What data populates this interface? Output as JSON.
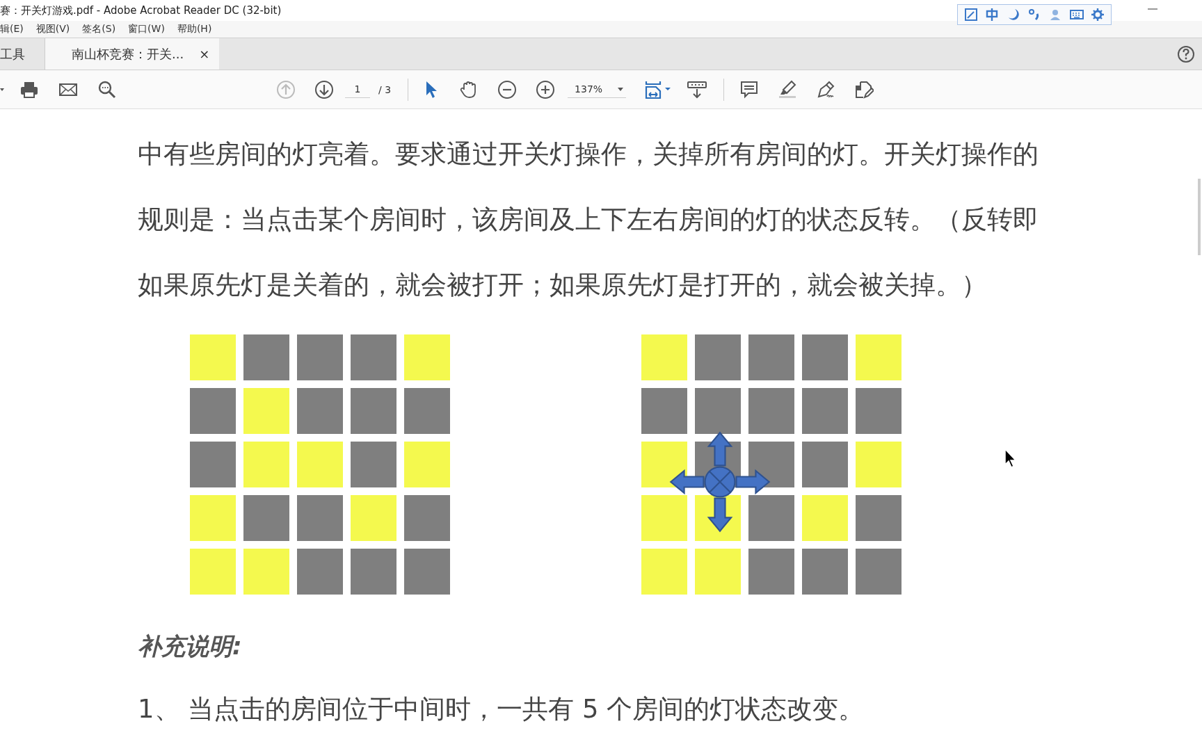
{
  "window": {
    "title": "赛：开关灯游戏.pdf - Adobe Acrobat Reader DC (32-bit)"
  },
  "menu": [
    "辑(E)",
    "视图(V)",
    "签名(S)",
    "窗口(W)",
    "帮助(H)"
  ],
  "tabs": [
    {
      "label": "工具",
      "selected": false,
      "closable": false
    },
    {
      "label": "南山杯竞赛：开关...",
      "selected": true,
      "closable": true
    }
  ],
  "tab_close": "×",
  "toolbar": {
    "page": "1",
    "page_total": "/ 3",
    "zoom": "137%"
  },
  "document": {
    "lines": [
      "中有些房间的灯亮着。要求通过开关灯操作，关掉所有房间的灯。开关灯操作的",
      "规则是：当点击某个房间时，该房间及上下左右房间的灯的状态反转。（反转即",
      "如果原先灯是关着的，就会被打开；如果原先灯是打开的，就会被关掉。）"
    ],
    "grids": [
      {
        "rows": [
          [
            {
              "on": true
            },
            {
              "on": false
            },
            {
              "on": false
            },
            {
              "on": false
            },
            {
              "on": true
            }
          ],
          [
            {
              "on": false
            },
            {
              "on": true
            },
            {
              "on": false
            },
            {
              "on": false
            },
            {
              "on": false
            }
          ],
          [
            {
              "on": false
            },
            {
              "on": true
            },
            {
              "on": true
            },
            {
              "on": false
            },
            {
              "on": true
            }
          ],
          [
            {
              "on": true
            },
            {
              "on": false
            },
            {
              "on": false
            },
            {
              "on": true
            },
            {
              "on": false
            }
          ],
          [
            {
              "on": true
            },
            {
              "on": true
            },
            {
              "on": false
            },
            {
              "on": false
            },
            {
              "on": false
            }
          ]
        ]
      },
      {
        "marker": true,
        "rows": [
          [
            {
              "on": true
            },
            {
              "on": false
            },
            {
              "on": false
            },
            {
              "on": false
            },
            {
              "on": true
            }
          ],
          [
            {
              "on": false
            },
            {
              "on": false
            },
            {
              "on": false
            },
            {
              "on": false
            },
            {
              "on": false
            }
          ],
          [
            {
              "on": true
            },
            {
              "on": false
            },
            {
              "on": false
            },
            {
              "on": false
            },
            {
              "on": true
            }
          ],
          [
            {
              "on": true
            },
            {
              "on": true
            },
            {
              "on": false
            },
            {
              "on": true
            },
            {
              "on": false
            }
          ],
          [
            {
              "on": true
            },
            {
              "on": true
            },
            {
              "on": false
            },
            {
              "on": false
            },
            {
              "on": false
            }
          ]
        ]
      }
    ],
    "heading": "补充说明:",
    "items": [
      "1、 当点击的房间位于中间时，一共有 5 个房间的灯状态改变。"
    ]
  }
}
